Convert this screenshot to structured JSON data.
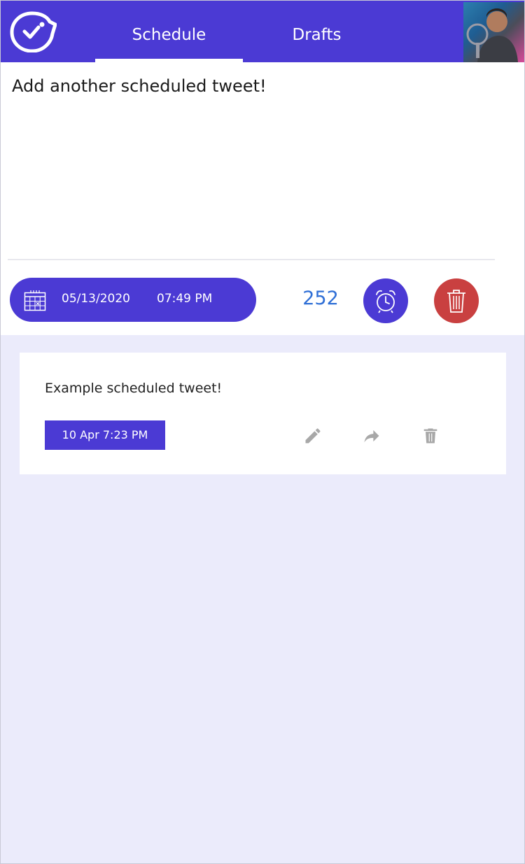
{
  "header": {
    "tabs": [
      {
        "label": "Schedule",
        "active": true
      },
      {
        "label": "Drafts",
        "active": false
      }
    ],
    "logo_icon": "bird-clock-logo-icon",
    "avatar_icon": "user-avatar"
  },
  "composer": {
    "text": "Add another scheduled tweet!",
    "date": "05/13/2020",
    "time": "07:49  PM",
    "char_count": "252",
    "calendar_icon": "calendar-icon",
    "schedule_icon": "alarm-clock-icon",
    "delete_icon": "trash-icon"
  },
  "scheduled": [
    {
      "text": "Example scheduled tweet!",
      "date_label": "10 Apr 7:23 PM",
      "icons": [
        "pencil-icon",
        "share-arrow-icon",
        "trash-icon"
      ]
    }
  ],
  "colors": {
    "brand": "#4b3ad4",
    "danger": "#c94040",
    "counter": "#2f6fd6",
    "page_bg": "#ebebfb",
    "muted_icon": "#a8a8a8"
  }
}
